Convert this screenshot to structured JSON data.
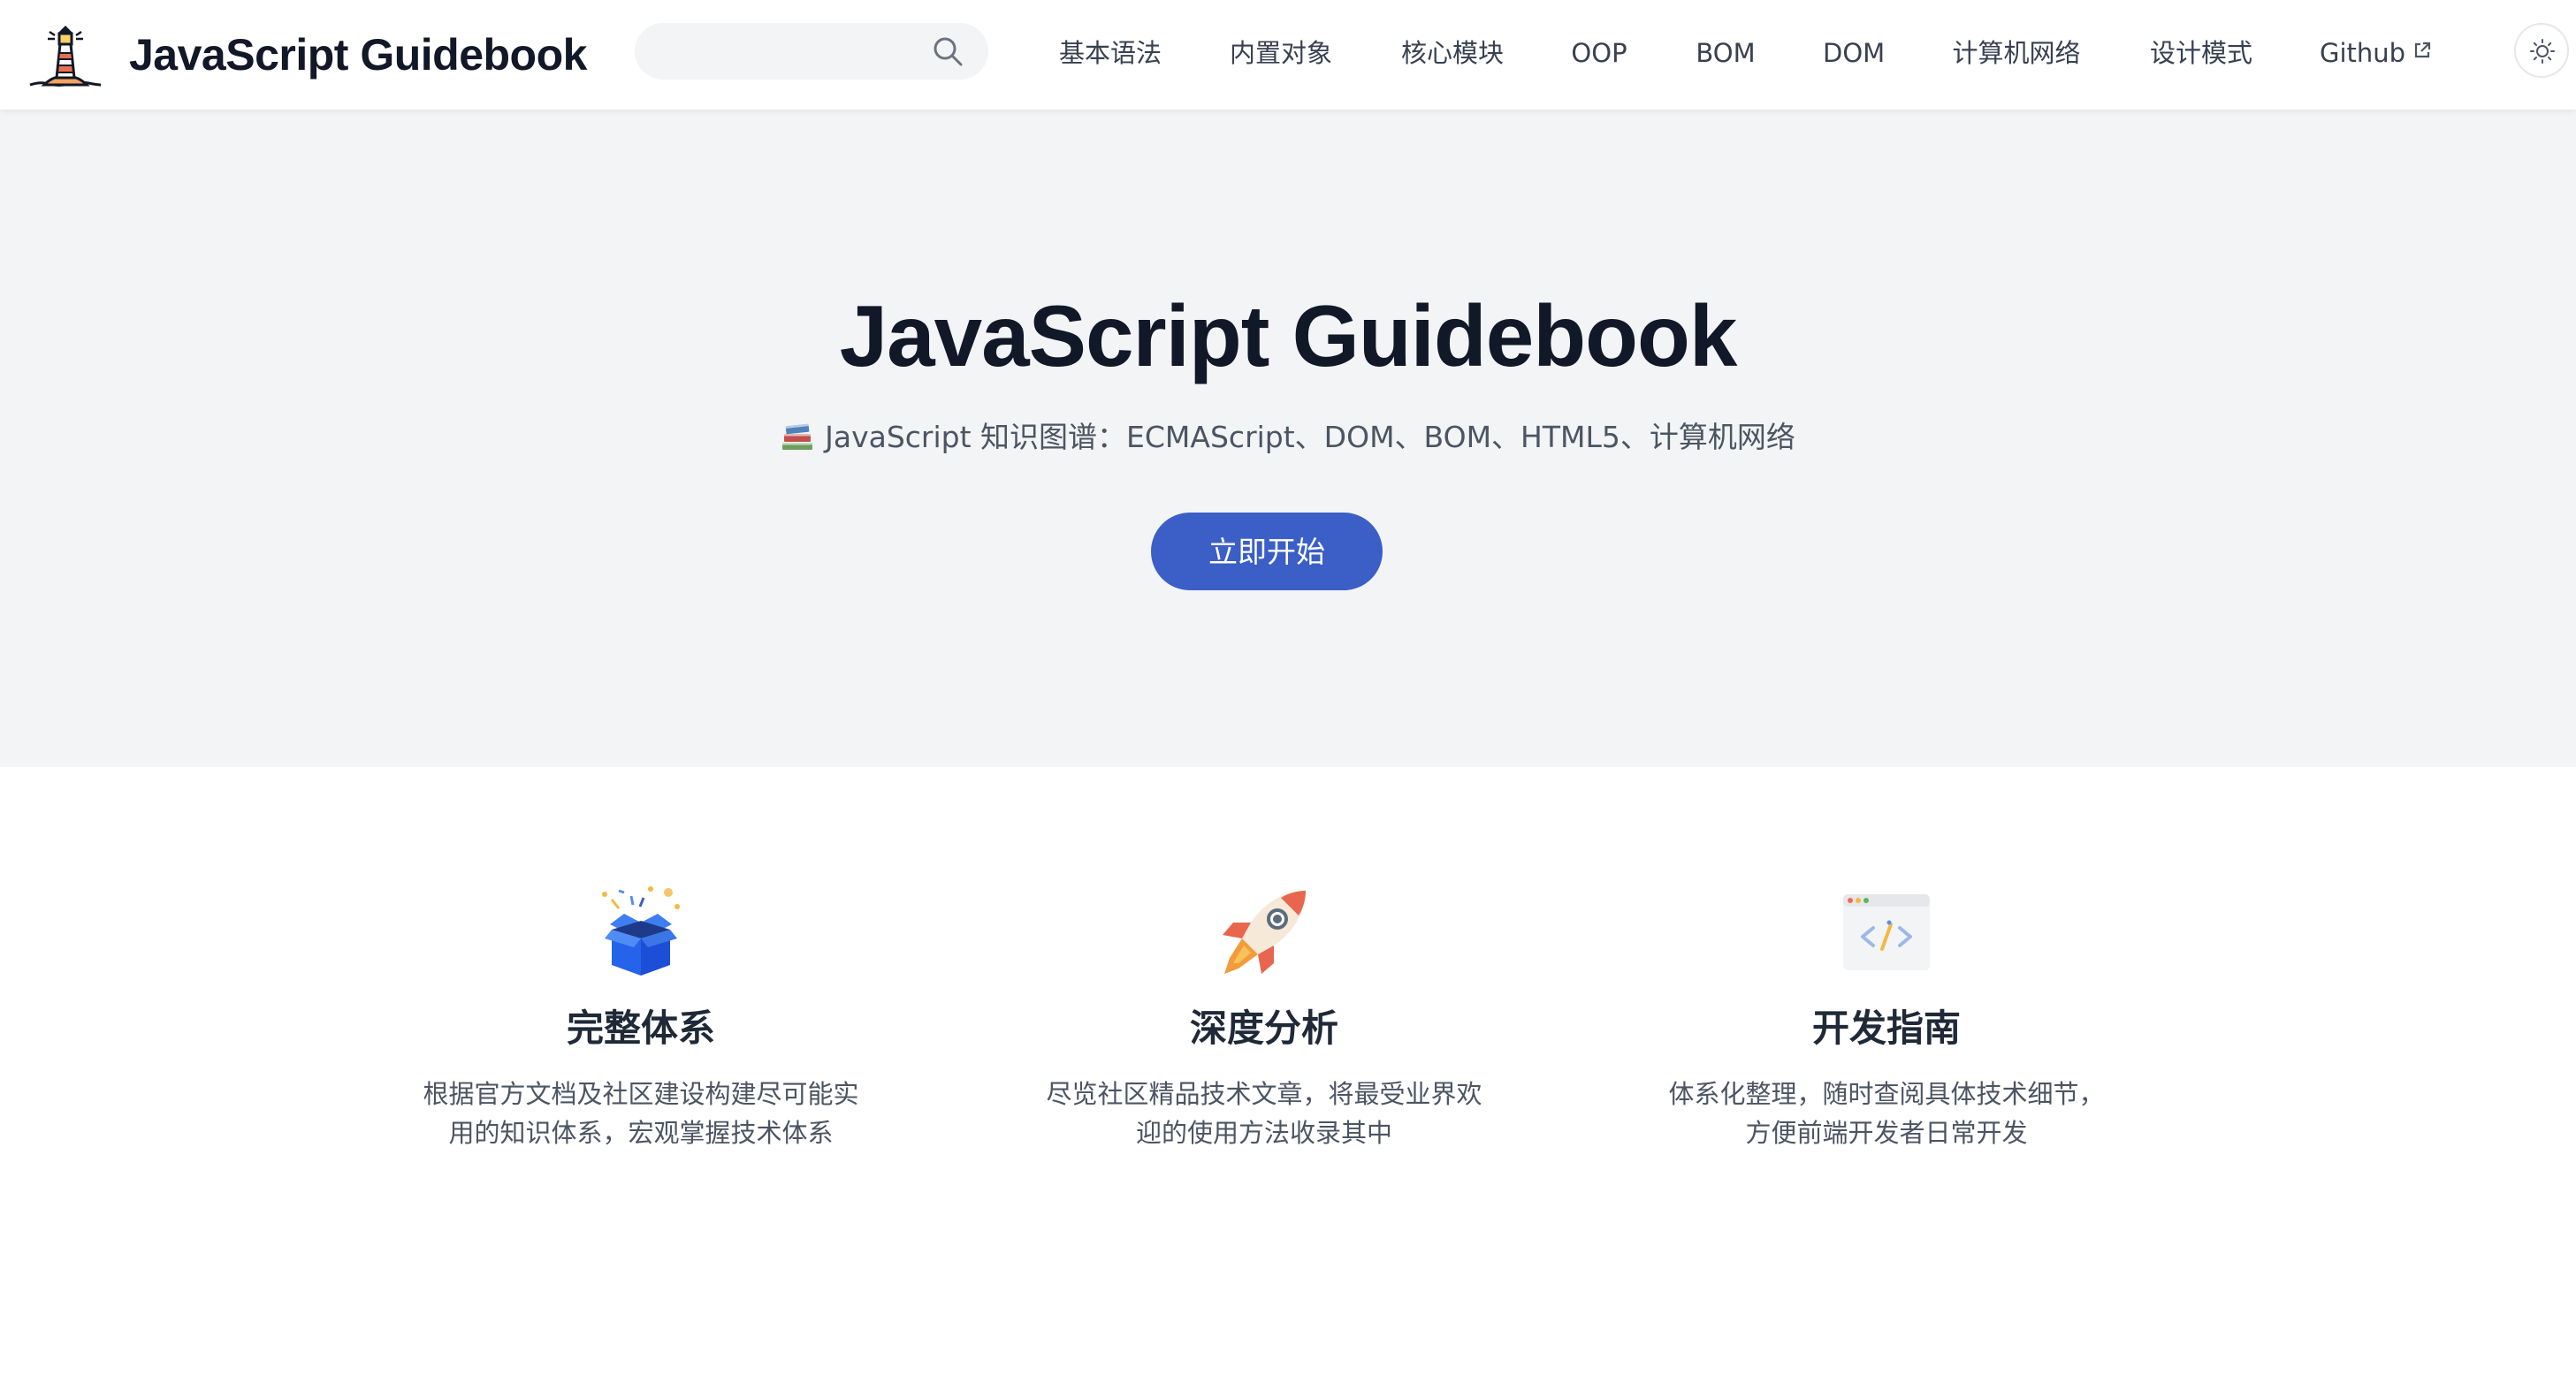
{
  "header": {
    "site_title": "JavaScript Guidebook",
    "logo_icon": "lighthouse-icon",
    "search": {
      "value": "",
      "placeholder": "",
      "icon": "search-icon"
    },
    "nav": [
      {
        "label": "基本语法"
      },
      {
        "label": "内置对象"
      },
      {
        "label": "核心模块"
      },
      {
        "label": "OOP"
      },
      {
        "label": "BOM"
      },
      {
        "label": "DOM"
      },
      {
        "label": "计算机网络"
      },
      {
        "label": "设计模式"
      },
      {
        "label": "Github",
        "icon": "external-link-icon"
      }
    ],
    "theme_toggle_icon": "sun-icon"
  },
  "hero": {
    "title": "JavaScript Guidebook",
    "subtitle_icon": "books-icon",
    "subtitle": "JavaScript 知识图谱：ECMAScript、DOM、BOM、HTML5、计算机网络",
    "cta_label": "立即开始"
  },
  "features": [
    {
      "icon": "gift-box-icon",
      "title": "完整体系",
      "desc_line1": "根据官方文档及社区建设构建尽可能实",
      "desc_line2": "用的知识体系，宏观掌握技术体系"
    },
    {
      "icon": "rocket-icon",
      "title": "深度分析",
      "desc_line1": "尽览社区精品技术文章，将最受业界欢",
      "desc_line2": "迎的使用方法收录其中"
    },
    {
      "icon": "code-window-icon",
      "title": "开发指南",
      "desc_line1": "体系化整理，随时查阅具体技术细节，",
      "desc_line2": "方便前端开发者日常开发"
    }
  ],
  "colors": {
    "accent": "#3b5fc7",
    "hero_background": "#f3f4f6",
    "title_text": "#111827",
    "body_text": "#4b5563"
  }
}
